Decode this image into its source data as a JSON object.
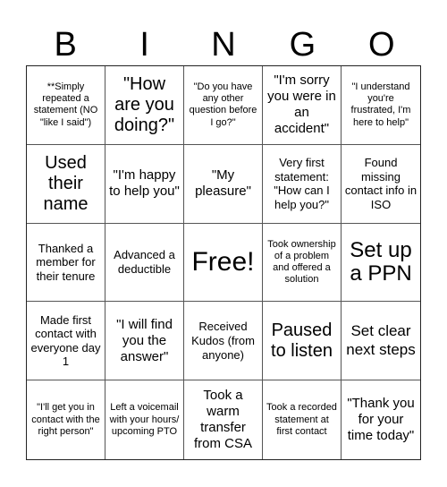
{
  "header": {
    "letters": [
      "B",
      "I",
      "N",
      "G",
      "O"
    ]
  },
  "card": {
    "rows": [
      [
        "**Simply repeated a statement (NO \"like I said\")",
        "\"How are you doing?\"",
        "\"Do you have any other question before I go?\"",
        "\"I'm sorry you were in an accident\"",
        "\"I understand you're frustrated, I'm here to help\""
      ],
      [
        "Used their name",
        "\"I'm happy to help you\"",
        "\"My pleasure\"",
        "Very first statement: \"How can I help you?\"",
        "Found missing contact info in ISO"
      ],
      [
        "Thanked a member for their tenure",
        "Advanced a deductible",
        "Free!",
        "Took ownership of a problem and offered a solution",
        "Set up a PPN"
      ],
      [
        "Made first contact with everyone day 1",
        "\"I will find you the answer\"",
        "Received Kudos (from anyone)",
        "Paused to listen",
        "Set clear next steps"
      ],
      [
        "\"I'll get you in contact with the right person\"",
        "Left a voicemail with your hours/ upcoming PTO",
        "Took a warm transfer from CSA",
        "Took a recorded statement at first contact",
        "\"Thank you for your time today\""
      ]
    ],
    "free_space": "Free!"
  }
}
